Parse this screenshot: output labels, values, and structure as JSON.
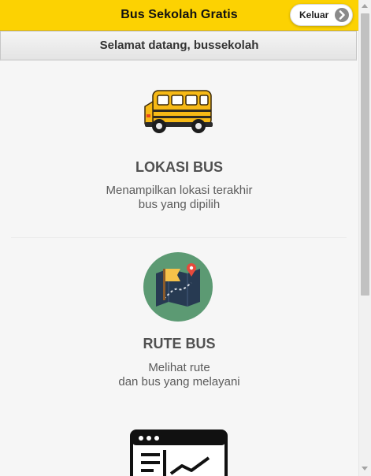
{
  "header": {
    "title": "Bus Sekolah Gratis",
    "logout_label": "Keluar",
    "logout_icon": "arrow-circle-right-icon",
    "bg_color": "#fcd202"
  },
  "welcome": {
    "text": "Selamat datang, bussekolah"
  },
  "menu": [
    {
      "icon": "school-bus-icon",
      "title": "LOKASI BUS",
      "desc_lines": [
        "Menampilkan lokasi terakhir",
        "bus yang dipilih"
      ]
    },
    {
      "icon": "route-map-icon",
      "title": "RUTE BUS",
      "desc_lines": [
        "Melihat rute",
        "dan bus yang melayani"
      ]
    },
    {
      "icon": "schedule-chart-icon"
    }
  ]
}
